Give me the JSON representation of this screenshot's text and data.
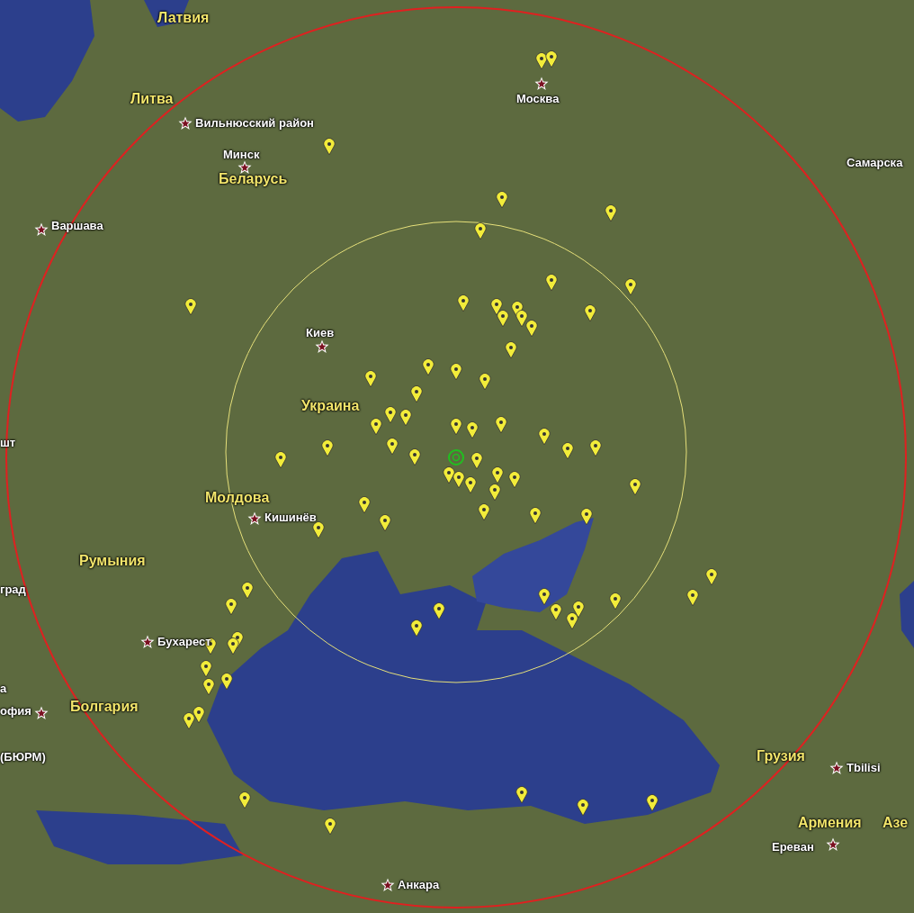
{
  "map": {
    "labels": [
      {
        "kind": "country",
        "text": "Латвия"
      },
      {
        "kind": "city",
        "text": "Москва"
      },
      {
        "kind": "country",
        "text": "Литва"
      },
      {
        "kind": "city",
        "text": "Вильнюсский район"
      },
      {
        "kind": "city",
        "text": "Минск"
      },
      {
        "kind": "place",
        "text": "Самарска"
      },
      {
        "kind": "country",
        "text": "Беларусь"
      },
      {
        "kind": "city",
        "text": "Варшава"
      },
      {
        "kind": "city",
        "text": "Киев"
      },
      {
        "kind": "country",
        "text": "Украина"
      },
      {
        "kind": "place",
        "text": "шт"
      },
      {
        "kind": "country",
        "text": "Молдова"
      },
      {
        "kind": "city",
        "text": "Кишинёв"
      },
      {
        "kind": "country",
        "text": "Румыния"
      },
      {
        "kind": "place",
        "text": "град"
      },
      {
        "kind": "city",
        "text": "Бухарест"
      },
      {
        "kind": "place",
        "text": "а"
      },
      {
        "kind": "country",
        "text": "Болгария"
      },
      {
        "kind": "city",
        "text": "офия"
      },
      {
        "kind": "country",
        "text": "Грузия"
      },
      {
        "kind": "place",
        "text": "(БЮРМ)"
      },
      {
        "kind": "city",
        "text": "Tbilisi"
      },
      {
        "kind": "country",
        "text": "Армения"
      },
      {
        "kind": "country",
        "text": "Азе"
      },
      {
        "kind": "city",
        "text": "Ереван"
      },
      {
        "kind": "city",
        "text": "Анкара"
      }
    ]
  }
}
